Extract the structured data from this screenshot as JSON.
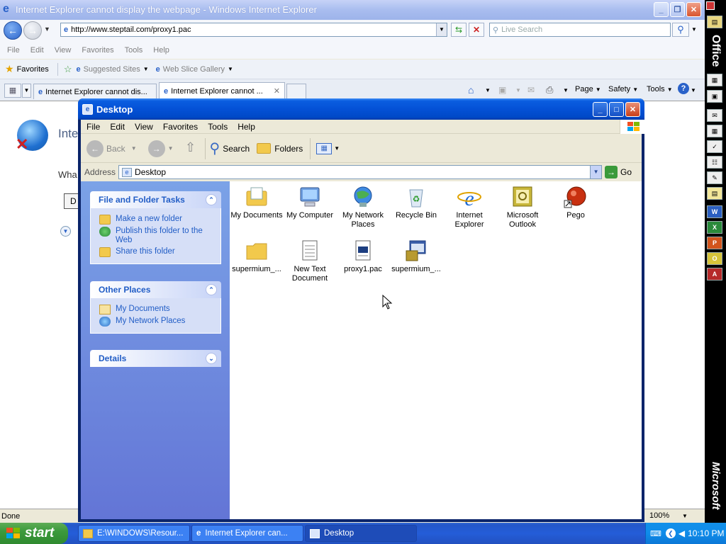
{
  "ie": {
    "title": "Internet Explorer cannot display the webpage - Windows Internet Explorer",
    "url": "http://www.steptail.com/proxy1.pac",
    "search_placeholder": "Live Search",
    "menu": [
      "File",
      "Edit",
      "View",
      "Favorites",
      "Tools",
      "Help"
    ],
    "favorites_label": "Favorites",
    "suggested_sites": "Suggested Sites",
    "web_slice_gallery": "Web Slice Gallery",
    "tabs": [
      "Internet Explorer cannot dis...",
      "Internet Explorer cannot ..."
    ],
    "cmd": {
      "page": "Page",
      "safety": "Safety",
      "tools": "Tools"
    },
    "content_heading": "Inte",
    "content_text": "Wha",
    "content_btn": "D",
    "status": "Done",
    "zoom": "100%"
  },
  "explorer": {
    "title": "Desktop",
    "menu": [
      "File",
      "Edit",
      "View",
      "Favorites",
      "Tools",
      "Help"
    ],
    "toolbar": {
      "back": "Back",
      "search": "Search",
      "folders": "Folders"
    },
    "address_label": "Address",
    "address_value": "Desktop",
    "go_label": "Go",
    "panels": {
      "tasks": {
        "title": "File and Folder Tasks",
        "items": [
          "Make a new folder",
          "Publish this folder to the Web",
          "Share this folder"
        ]
      },
      "places": {
        "title": "Other Places",
        "items": [
          "My Documents",
          "My Network Places"
        ]
      },
      "details": {
        "title": "Details"
      }
    },
    "icons": [
      {
        "label": "My Documents",
        "icon": "my-documents-icon"
      },
      {
        "label": "My Computer",
        "icon": "my-computer-icon"
      },
      {
        "label": "My Network Places",
        "icon": "network-places-icon"
      },
      {
        "label": "Recycle Bin",
        "icon": "recycle-bin-icon"
      },
      {
        "label": "Internet Explorer",
        "icon": "internet-explorer-icon"
      },
      {
        "label": "Microsoft Outlook",
        "icon": "outlook-icon"
      },
      {
        "label": "Pego",
        "icon": "pego-icon"
      },
      {
        "label": "supermium_...",
        "icon": "folder-icon"
      },
      {
        "label": "New Text Document",
        "icon": "text-document-icon"
      },
      {
        "label": "proxy1.pac",
        "icon": "pac-file-icon"
      },
      {
        "label": "supermium_...",
        "icon": "installer-icon"
      }
    ]
  },
  "office_bar": {
    "top_label": "Office",
    "bottom_label": "Microsoft"
  },
  "taskbar": {
    "start": "start",
    "tasks": [
      "E:\\WINDOWS\\Resour...",
      "Internet Explorer can...",
      "Desktop"
    ],
    "clock": "10:10 PM"
  },
  "colors": {
    "xp_blue": "#0451d6",
    "taskbar": "#245dd8",
    "start_green": "#3c9a3c",
    "panel_link": "#215dc6"
  }
}
